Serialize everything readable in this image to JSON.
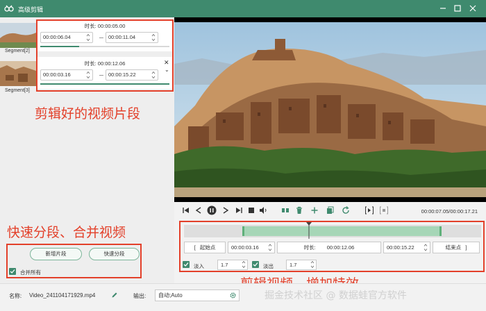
{
  "window": {
    "title": "高级剪辑"
  },
  "segments": [
    {
      "label": "Segment[2]",
      "duration_label": "时长:",
      "duration": "00:00:05.00",
      "start": "00:00:06.04",
      "end": "00:00:11.04",
      "progress": 0.3
    },
    {
      "label": "Segment[3]",
      "duration_label": "时长:",
      "duration": "00:00:12.06",
      "start": "00:00:03.16",
      "end": "00:00:15.22",
      "progress": 1.0
    }
  ],
  "annotations": {
    "segments": "剪辑好的视频片段",
    "split_merge": "快速分段、合并视频",
    "edit_effects": "剪辑视频、增加特效"
  },
  "left_actions": {
    "new_segment": "新增片段",
    "quick_split": "快速分段",
    "merge_all": "合并所有",
    "merge_all_checked": true
  },
  "player": {
    "current": "00:00:07.05",
    "total": "00:00:17.21",
    "timecode": "00:00:07.05/00:00:17.21"
  },
  "trim": {
    "start_label": "起始点",
    "start": "00:00:03.16",
    "duration_label": "时长:",
    "duration": "00:00:12.06",
    "end": "00:00:15.22",
    "end_label": "结束点",
    "fade_in_label": "淡入",
    "fade_in": "1.7",
    "fade_in_checked": true,
    "fade_out_label": "淡出",
    "fade_out": "1.7",
    "fade_out_checked": true
  },
  "bottom": {
    "name_label": "名称:",
    "filename": "Video_241104171929.mp4",
    "output_label": "输出:",
    "output_value": "自动;Auto",
    "watermark": "掘金技术社区 @ 数据蛙官方软件"
  },
  "colors": {
    "titlebar": "#3f8a6e",
    "accent": "#3f8a6e",
    "annotation": "#e3402a",
    "selection": "#a6d6b7"
  }
}
